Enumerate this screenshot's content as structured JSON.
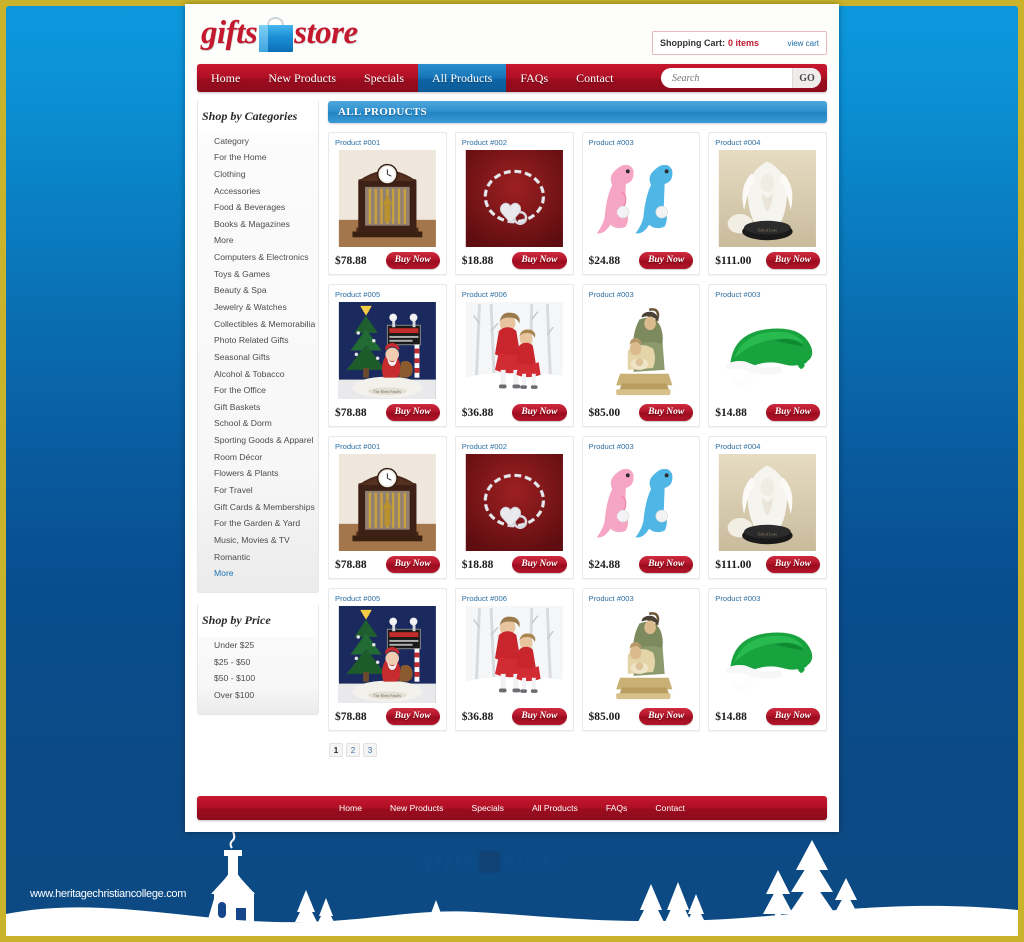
{
  "theme": {
    "frame_color": "#c8b32a",
    "backdrop_top": "#0d98dd",
    "backdrop_bottom": "#0d4a84",
    "brand_red": "#c3182e",
    "accent_blue": "#2385c4",
    "link_blue": "#1d74b5"
  },
  "header": {
    "logo_word_1": "gifts",
    "logo_word_2": "store",
    "logo_bag_icon": "shopping-bag-icon",
    "cart_label": "Shopping Cart:",
    "cart_count": "0 items",
    "view_cart": "view cart"
  },
  "nav": {
    "items": [
      {
        "label": "Home",
        "active": false
      },
      {
        "label": "New Products",
        "active": false
      },
      {
        "label": "Specials",
        "active": false
      },
      {
        "label": "All Products",
        "active": true
      },
      {
        "label": "FAQs",
        "active": false
      },
      {
        "label": "Contact",
        "active": false
      }
    ],
    "search_placeholder": "Search",
    "search_value": "",
    "go_label": "GO"
  },
  "sidebar": {
    "categories_title": "Shop by Categories",
    "categories": [
      {
        "label": "Category"
      },
      {
        "label": "For the Home"
      },
      {
        "label": "Clothing"
      },
      {
        "label": "Accessories"
      },
      {
        "label": "Food & Beverages"
      },
      {
        "label": "Books & Magazines"
      },
      {
        "label": "More"
      },
      {
        "label": "Computers & Electronics"
      },
      {
        "label": "Toys & Games"
      },
      {
        "label": "Beauty & Spa"
      },
      {
        "label": "Jewelry & Watches"
      },
      {
        "label": "Collectibles & Memorabilia"
      },
      {
        "label": "Photo Related Gifts"
      },
      {
        "label": "Seasonal Gifts"
      },
      {
        "label": "Alcohol & Tobacco"
      },
      {
        "label": "For the Office"
      },
      {
        "label": "Gift Baskets"
      },
      {
        "label": "School & Dorm"
      },
      {
        "label": "Sporting Goods & Apparel"
      },
      {
        "label": "Room Décor"
      },
      {
        "label": "Flowers & Plants"
      },
      {
        "label": "For Travel"
      },
      {
        "label": "Gift Cards & Memberships"
      },
      {
        "label": "For the Garden & Yard"
      },
      {
        "label": "Music, Movies & TV"
      },
      {
        "label": "Romantic"
      },
      {
        "label": "More",
        "highlight": true
      }
    ],
    "price_title": "Shop by Price",
    "prices": [
      {
        "label": "Under $25"
      },
      {
        "label": "$25 - $50"
      },
      {
        "label": "$50 - $100"
      },
      {
        "label": "Over $100"
      }
    ]
  },
  "content": {
    "title": "ALL PRODUCTS",
    "buy_label": "Buy Now",
    "products": [
      {
        "name": "Product #001",
        "price": "$78.88",
        "image": "mantel-clock-image"
      },
      {
        "name": "Product #002",
        "price": "$18.88",
        "image": "heart-charm-bracelet-image"
      },
      {
        "name": "Product #003",
        "price": "$24.88",
        "image": "pink-blue-dinosaur-figurines-image"
      },
      {
        "name": "Product #004",
        "price": "$111.00",
        "image": "white-angel-figurine-image"
      },
      {
        "name": "Product #005",
        "price": "$78.88",
        "image": "santa-christmas-tree-image"
      },
      {
        "name": "Product #006",
        "price": "$36.88",
        "image": "two-girls-red-dresses-image"
      },
      {
        "name": "Product #003",
        "price": "$85.00",
        "image": "nativity-figurine-image"
      },
      {
        "name": "Product #003",
        "price": "$14.88",
        "image": "green-santa-hat-image"
      },
      {
        "name": "Product #001",
        "price": "$78.88",
        "image": "mantel-clock-image"
      },
      {
        "name": "Product #002",
        "price": "$18.88",
        "image": "heart-charm-bracelet-image"
      },
      {
        "name": "Product #003",
        "price": "$24.88",
        "image": "pink-blue-dinosaur-figurines-image"
      },
      {
        "name": "Product #004",
        "price": "$111.00",
        "image": "white-angel-figurine-image"
      },
      {
        "name": "Product #005",
        "price": "$78.88",
        "image": "santa-christmas-tree-image"
      },
      {
        "name": "Product #006",
        "price": "$36.88",
        "image": "two-girls-red-dresses-image"
      },
      {
        "name": "Product #003",
        "price": "$85.00",
        "image": "nativity-figurine-image"
      },
      {
        "name": "Product #003",
        "price": "$14.88",
        "image": "green-santa-hat-image"
      }
    ],
    "pagination": [
      {
        "label": "1",
        "active": true
      },
      {
        "label": "2",
        "active": false
      },
      {
        "label": "3",
        "active": false
      }
    ]
  },
  "footer": {
    "links": [
      "Home",
      "New Products",
      "Specials",
      "All Products",
      "FAQs",
      "Contact"
    ],
    "logo_word_1": "gifts",
    "logo_word_2": "store",
    "watermark": "www.heritagechristiancollege.com"
  }
}
